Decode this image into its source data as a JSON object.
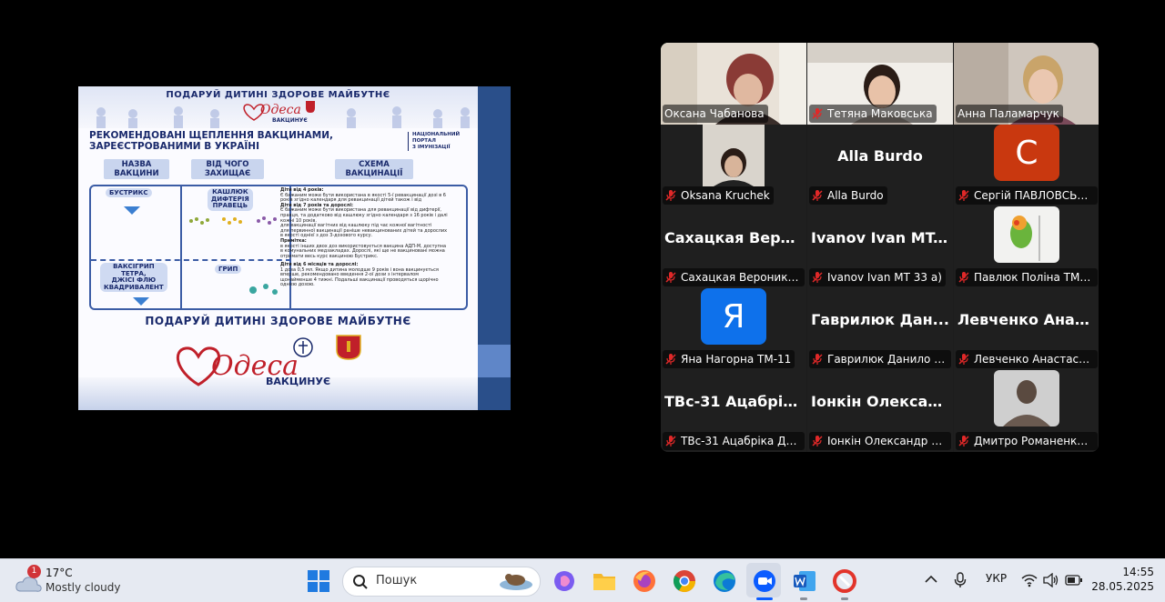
{
  "shared_screen": {
    "poster": {
      "top_title": "ПОДАРУЙ  ДИТИНІ ЗДОРОВЕ МАЙБУТНЄ",
      "logo_word": "Одеса",
      "logo_sub": "ВАКЦИНУЄ",
      "subtitle_line1": "РЕКОМЕНДОВАНІ ЩЕПЛЕННЯ ВАКЦИНАМИ,",
      "subtitle_line2": "ЗАРЕЄСТРОВАНИМИ В УКРАЇНІ",
      "portal_line1": "НАЦІОНАЛЬНИЙ",
      "portal_line2": "ПОРТАЛ",
      "portal_line3": "З ІМУНІЗАЦІЇ",
      "col1_line1": "НАЗВА",
      "col1_line2": "ВАКЦИНИ",
      "col2_line1": "ВІД ЧОГО",
      "col2_line2": "ЗАХИЩАЄ",
      "col3_line1": "СХЕМА",
      "col3_line2": "ВАКЦИНАЦІЇ",
      "vaccine1": "БУСТРИКС",
      "disease1_line1": "КАШЛЮК",
      "disease1_line2": "ДИФТЕРІЯ",
      "disease1_line3": "ПРАВЕЦЬ",
      "vaccine2_line1": "ВАКСІГРИП",
      "vaccine2_line2": "ТЕТРА,",
      "vaccine2_line3": "ДЖІСІ ФЛЮ",
      "vaccine2_line4": "КВАДРИВАЛЕНТ",
      "disease2": "ГРИП",
      "scheme1_head": "Діти від 4 років:",
      "scheme1_text": "Є бажаним може бути використана в якості 5-ї ревакцинації дозі в 6 років згідно календаря для ревакцинації дітей також і від",
      "scheme1_head2": "Діти від 7 років та дорослі:",
      "scheme1_text2": "Є бажаним може бути використана для ревакцинації від дифтерії, правця, та додатково від кашлюку згідно календаря з 16 років і далі кожні 10 років.",
      "scheme1_bullet1": "для вакцинації вагітних від кашлюку під час кожної вагітності",
      "scheme1_bullet2": "для первинної вакцинації раніше невакцинованих дітей та дорослих в якості однієї з доз 3-дозового курсу.",
      "scheme1_note_head": "Примітка:",
      "scheme1_note": "в якості інших двох доз використовується вакцина АДП-М, доступна в комунальних медзакладах. Дорослі, які ще не вакциновані можна отримати весь курс вакциною Бустрикс.",
      "scheme2_head": "Діти від 6 місяців та дорослі:",
      "scheme2_text": "1 доза 0,5 мл. Якщо дитина молодше 9 років і вона вакцинується вперше, рекомендовано введення 2-ої дози з інтервалом щонайменше 4 тижні. Подальші вакцинації проводяться щорічно однією дозою.",
      "bottom_title": "ПОДАРУЙ  ДИТИНІ ЗДОРОВЕ МАЙБУТНЄ",
      "bottom_logo_word": "Одеса",
      "bottom_logo_sub": "ВАКЦИНУЄ"
    }
  },
  "gallery": {
    "tiles": [
      {
        "name": "Оксана Чабанова",
        "type": "video",
        "muted": false,
        "active": true
      },
      {
        "name": "Тетяна Маковська",
        "type": "video",
        "muted": true
      },
      {
        "name": "Анна Паламарчук",
        "type": "video",
        "muted": false
      },
      {
        "name": "Oksana Kruchek",
        "type": "video",
        "muted": true
      },
      {
        "name": "Alla Burdo",
        "type": "name",
        "big": "Alla Burdo",
        "muted": true
      },
      {
        "name": "Сергій ПАВЛОВСЬКИЙ",
        "type": "avatar",
        "letter": "C",
        "avatar_color": "#c9380f",
        "muted": true
      },
      {
        "name": "Сахацкая Вероника Т...",
        "type": "name",
        "big": "Сахацкая  Веро...",
        "muted": true
      },
      {
        "name": "Ivanov Ivan MT 33 a)",
        "type": "name",
        "big": "Ivanov  Ivan  MT...",
        "muted": true
      },
      {
        "name": "Павлюк Поліна ТМ-25",
        "type": "photo",
        "muted": true
      },
      {
        "name": "Яна Нагорна ТМ-11",
        "type": "avatar",
        "letter": "Я",
        "avatar_color": "#0e71eb",
        "muted": true
      },
      {
        "name": "Гаврилюк Данило ТМ...",
        "type": "name",
        "big": "Гаврилюк  Дан...",
        "muted": true
      },
      {
        "name": "Левченко Анастасия ...",
        "type": "name",
        "big": "Левченко  Анас...",
        "muted": true
      },
      {
        "name": "ТВс-31 Ацабріка Дми...",
        "type": "name",
        "big": "ТВс-31  Ацабрік...",
        "muted": true
      },
      {
        "name": "Іонкін Олександр ТМ ...",
        "type": "name",
        "big": "Іонкін  Олексан...",
        "muted": true
      },
      {
        "name": "Дмитро Романенко Г...",
        "type": "photo2",
        "muted": true
      }
    ]
  },
  "taskbar": {
    "weather_badge": "1",
    "temperature": "17°C",
    "weather_desc": "Mostly cloudy",
    "search_placeholder": "Пошук",
    "language": "УКР",
    "time": "14:55",
    "date": "28.05.2025"
  },
  "colors": {
    "active_speaker": "#23d18b",
    "muted_red": "#e02828",
    "poster_navy": "#1a2a6c"
  }
}
